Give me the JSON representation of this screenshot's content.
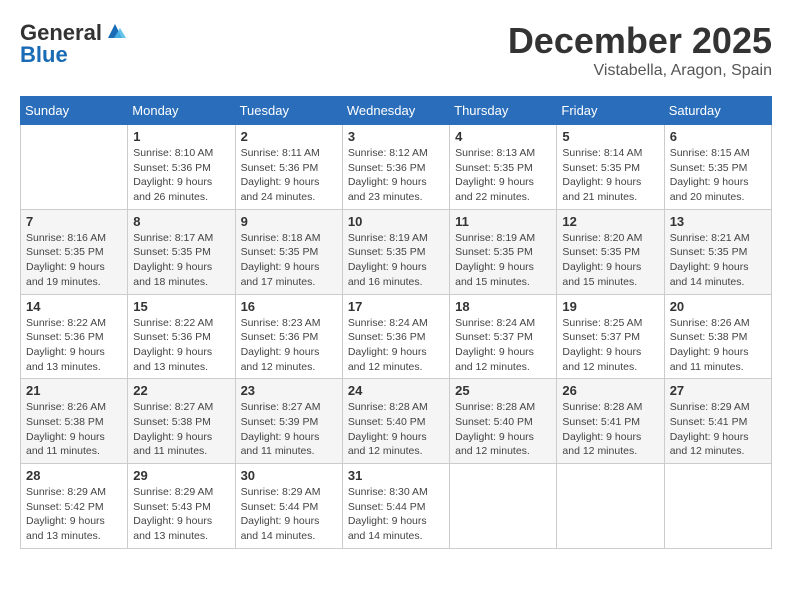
{
  "header": {
    "logo_line1": "General",
    "logo_line2": "Blue",
    "month": "December 2025",
    "location": "Vistabella, Aragon, Spain"
  },
  "weekdays": [
    "Sunday",
    "Monday",
    "Tuesday",
    "Wednesday",
    "Thursday",
    "Friday",
    "Saturday"
  ],
  "weeks": [
    [
      {
        "day": "",
        "info": ""
      },
      {
        "day": "1",
        "info": "Sunrise: 8:10 AM\nSunset: 5:36 PM\nDaylight: 9 hours\nand 26 minutes."
      },
      {
        "day": "2",
        "info": "Sunrise: 8:11 AM\nSunset: 5:36 PM\nDaylight: 9 hours\nand 24 minutes."
      },
      {
        "day": "3",
        "info": "Sunrise: 8:12 AM\nSunset: 5:36 PM\nDaylight: 9 hours\nand 23 minutes."
      },
      {
        "day": "4",
        "info": "Sunrise: 8:13 AM\nSunset: 5:35 PM\nDaylight: 9 hours\nand 22 minutes."
      },
      {
        "day": "5",
        "info": "Sunrise: 8:14 AM\nSunset: 5:35 PM\nDaylight: 9 hours\nand 21 minutes."
      },
      {
        "day": "6",
        "info": "Sunrise: 8:15 AM\nSunset: 5:35 PM\nDaylight: 9 hours\nand 20 minutes."
      }
    ],
    [
      {
        "day": "7",
        "info": "Sunrise: 8:16 AM\nSunset: 5:35 PM\nDaylight: 9 hours\nand 19 minutes."
      },
      {
        "day": "8",
        "info": "Sunrise: 8:17 AM\nSunset: 5:35 PM\nDaylight: 9 hours\nand 18 minutes."
      },
      {
        "day": "9",
        "info": "Sunrise: 8:18 AM\nSunset: 5:35 PM\nDaylight: 9 hours\nand 17 minutes."
      },
      {
        "day": "10",
        "info": "Sunrise: 8:19 AM\nSunset: 5:35 PM\nDaylight: 9 hours\nand 16 minutes."
      },
      {
        "day": "11",
        "info": "Sunrise: 8:19 AM\nSunset: 5:35 PM\nDaylight: 9 hours\nand 15 minutes."
      },
      {
        "day": "12",
        "info": "Sunrise: 8:20 AM\nSunset: 5:35 PM\nDaylight: 9 hours\nand 15 minutes."
      },
      {
        "day": "13",
        "info": "Sunrise: 8:21 AM\nSunset: 5:35 PM\nDaylight: 9 hours\nand 14 minutes."
      }
    ],
    [
      {
        "day": "14",
        "info": "Sunrise: 8:22 AM\nSunset: 5:36 PM\nDaylight: 9 hours\nand 13 minutes."
      },
      {
        "day": "15",
        "info": "Sunrise: 8:22 AM\nSunset: 5:36 PM\nDaylight: 9 hours\nand 13 minutes."
      },
      {
        "day": "16",
        "info": "Sunrise: 8:23 AM\nSunset: 5:36 PM\nDaylight: 9 hours\nand 12 minutes."
      },
      {
        "day": "17",
        "info": "Sunrise: 8:24 AM\nSunset: 5:36 PM\nDaylight: 9 hours\nand 12 minutes."
      },
      {
        "day": "18",
        "info": "Sunrise: 8:24 AM\nSunset: 5:37 PM\nDaylight: 9 hours\nand 12 minutes."
      },
      {
        "day": "19",
        "info": "Sunrise: 8:25 AM\nSunset: 5:37 PM\nDaylight: 9 hours\nand 12 minutes."
      },
      {
        "day": "20",
        "info": "Sunrise: 8:26 AM\nSunset: 5:38 PM\nDaylight: 9 hours\nand 11 minutes."
      }
    ],
    [
      {
        "day": "21",
        "info": "Sunrise: 8:26 AM\nSunset: 5:38 PM\nDaylight: 9 hours\nand 11 minutes."
      },
      {
        "day": "22",
        "info": "Sunrise: 8:27 AM\nSunset: 5:38 PM\nDaylight: 9 hours\nand 11 minutes."
      },
      {
        "day": "23",
        "info": "Sunrise: 8:27 AM\nSunset: 5:39 PM\nDaylight: 9 hours\nand 11 minutes."
      },
      {
        "day": "24",
        "info": "Sunrise: 8:28 AM\nSunset: 5:40 PM\nDaylight: 9 hours\nand 12 minutes."
      },
      {
        "day": "25",
        "info": "Sunrise: 8:28 AM\nSunset: 5:40 PM\nDaylight: 9 hours\nand 12 minutes."
      },
      {
        "day": "26",
        "info": "Sunrise: 8:28 AM\nSunset: 5:41 PM\nDaylight: 9 hours\nand 12 minutes."
      },
      {
        "day": "27",
        "info": "Sunrise: 8:29 AM\nSunset: 5:41 PM\nDaylight: 9 hours\nand 12 minutes."
      }
    ],
    [
      {
        "day": "28",
        "info": "Sunrise: 8:29 AM\nSunset: 5:42 PM\nDaylight: 9 hours\nand 13 minutes."
      },
      {
        "day": "29",
        "info": "Sunrise: 8:29 AM\nSunset: 5:43 PM\nDaylight: 9 hours\nand 13 minutes."
      },
      {
        "day": "30",
        "info": "Sunrise: 8:29 AM\nSunset: 5:44 PM\nDaylight: 9 hours\nand 14 minutes."
      },
      {
        "day": "31",
        "info": "Sunrise: 8:30 AM\nSunset: 5:44 PM\nDaylight: 9 hours\nand 14 minutes."
      },
      {
        "day": "",
        "info": ""
      },
      {
        "day": "",
        "info": ""
      },
      {
        "day": "",
        "info": ""
      }
    ]
  ]
}
